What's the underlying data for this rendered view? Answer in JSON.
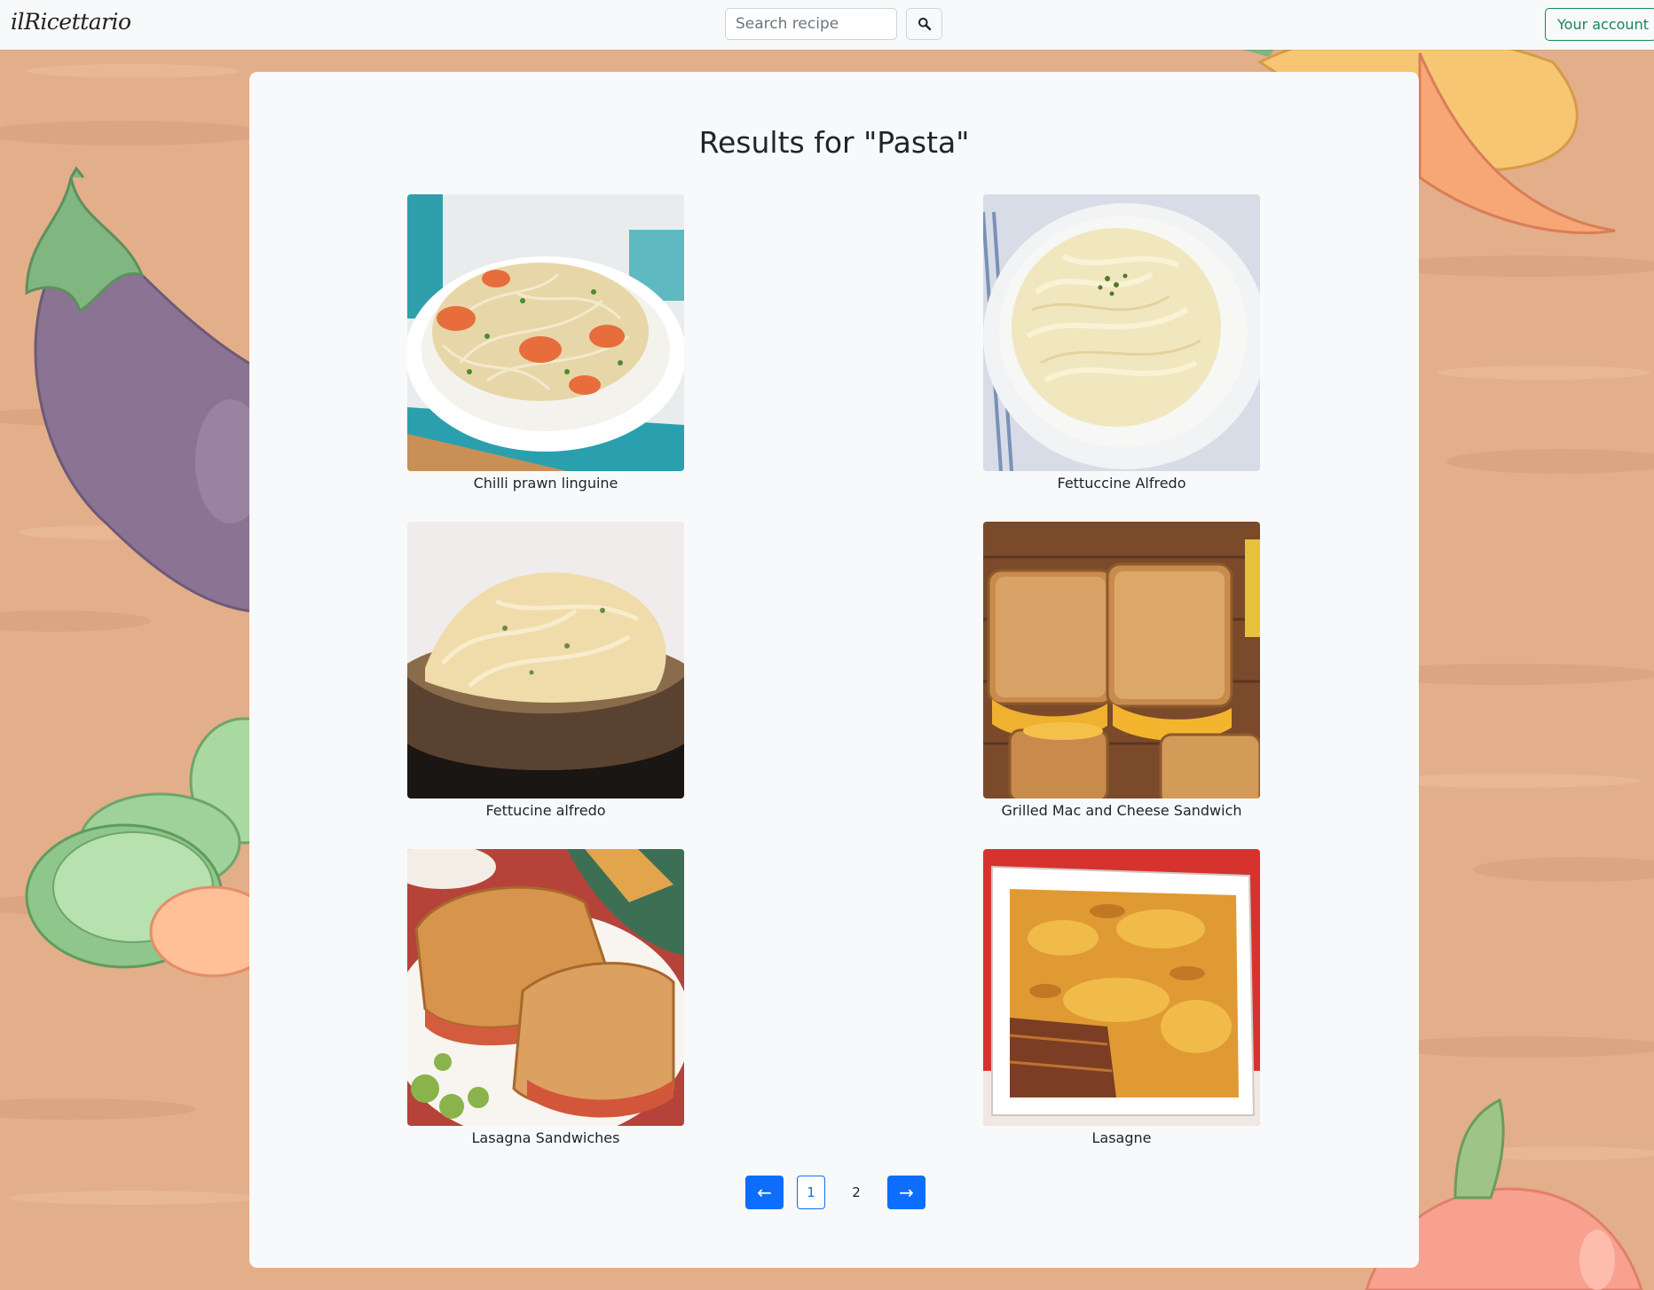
{
  "navbar": {
    "brand": "ilRicettario",
    "search_placeholder": "Search recipe",
    "search_value": "",
    "search_button_icon": "search-icon",
    "account_label": "Your account"
  },
  "main": {
    "title": "Results for \"Pasta\"",
    "recipes": [
      {
        "name": "Chilli prawn linguine"
      },
      {
        "name": "Fettuccine Alfredo"
      },
      {
        "name": "Fettucine alfredo"
      },
      {
        "name": "Grilled Mac and Cheese Sandwich"
      },
      {
        "name": "Lasagna Sandwiches"
      },
      {
        "name": "Lasagne"
      }
    ]
  },
  "pagination": {
    "prev_label": "←",
    "pages": [
      "1",
      "2"
    ],
    "current_page": "1",
    "next_label": "→"
  },
  "colors": {
    "primary": "#0d6efd",
    "success": "#198754",
    "background": "#e2ad88"
  }
}
